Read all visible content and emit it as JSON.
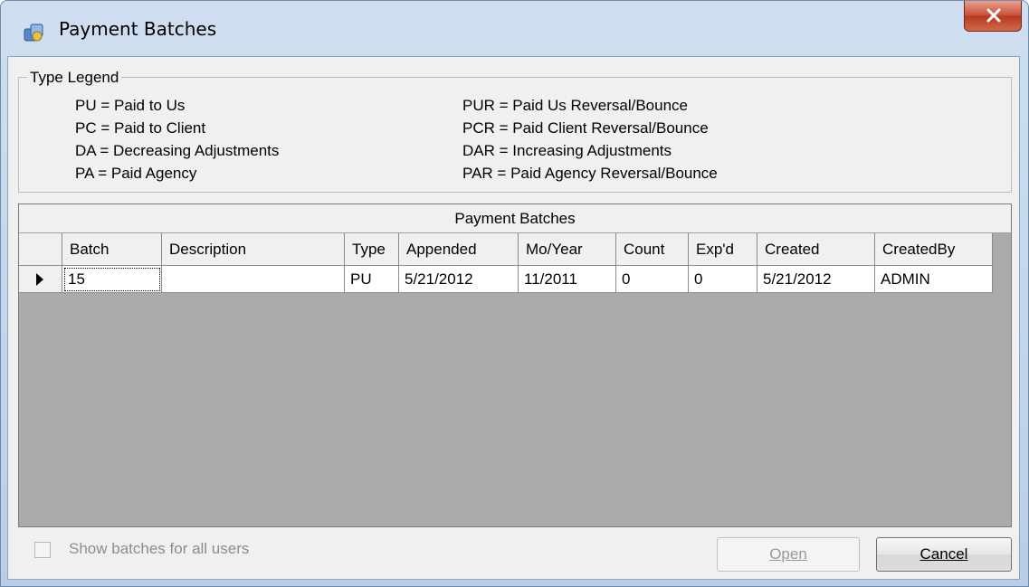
{
  "window": {
    "title": "Payment Batches",
    "colors": {
      "title_bar": "#c4d7ec",
      "close_button": "#c9503a",
      "client_bg": "#f0f0f0",
      "grid_bg": "#ababab"
    }
  },
  "legend": {
    "title": "Type Legend",
    "left_items": [
      "PU = Paid to Us",
      "PC = Paid to Client",
      "DA = Decreasing Adjustments",
      "PA = Paid Agency"
    ],
    "right_items": [
      "PUR = Paid Us Reversal/Bounce",
      "PCR = Paid Client Reversal/Bounce",
      "DAR = Increasing Adjustments",
      "PAR = Paid Agency Reversal/Bounce"
    ]
  },
  "grid": {
    "caption": "Payment Batches",
    "columns": [
      "Batch",
      "Description",
      "Type",
      "Appended",
      "Mo/Year",
      "Count",
      "Exp'd",
      "Created",
      "CreatedBy"
    ],
    "rows": [
      {
        "batch": "15",
        "description": "",
        "type": "PU",
        "appended": "5/21/2012",
        "mo_year": "11/2011",
        "count": "0",
        "expd": "0",
        "created": "5/21/2012",
        "created_by": "ADMIN"
      }
    ]
  },
  "footer": {
    "show_all_label": "Show batches for all users",
    "show_all_checked": false,
    "open_label": "Open",
    "cancel_label": "Cancel"
  },
  "icons": {
    "app": "payment-batches-icon",
    "close": "close-icon",
    "row_indicator": "row-pointer-icon"
  }
}
